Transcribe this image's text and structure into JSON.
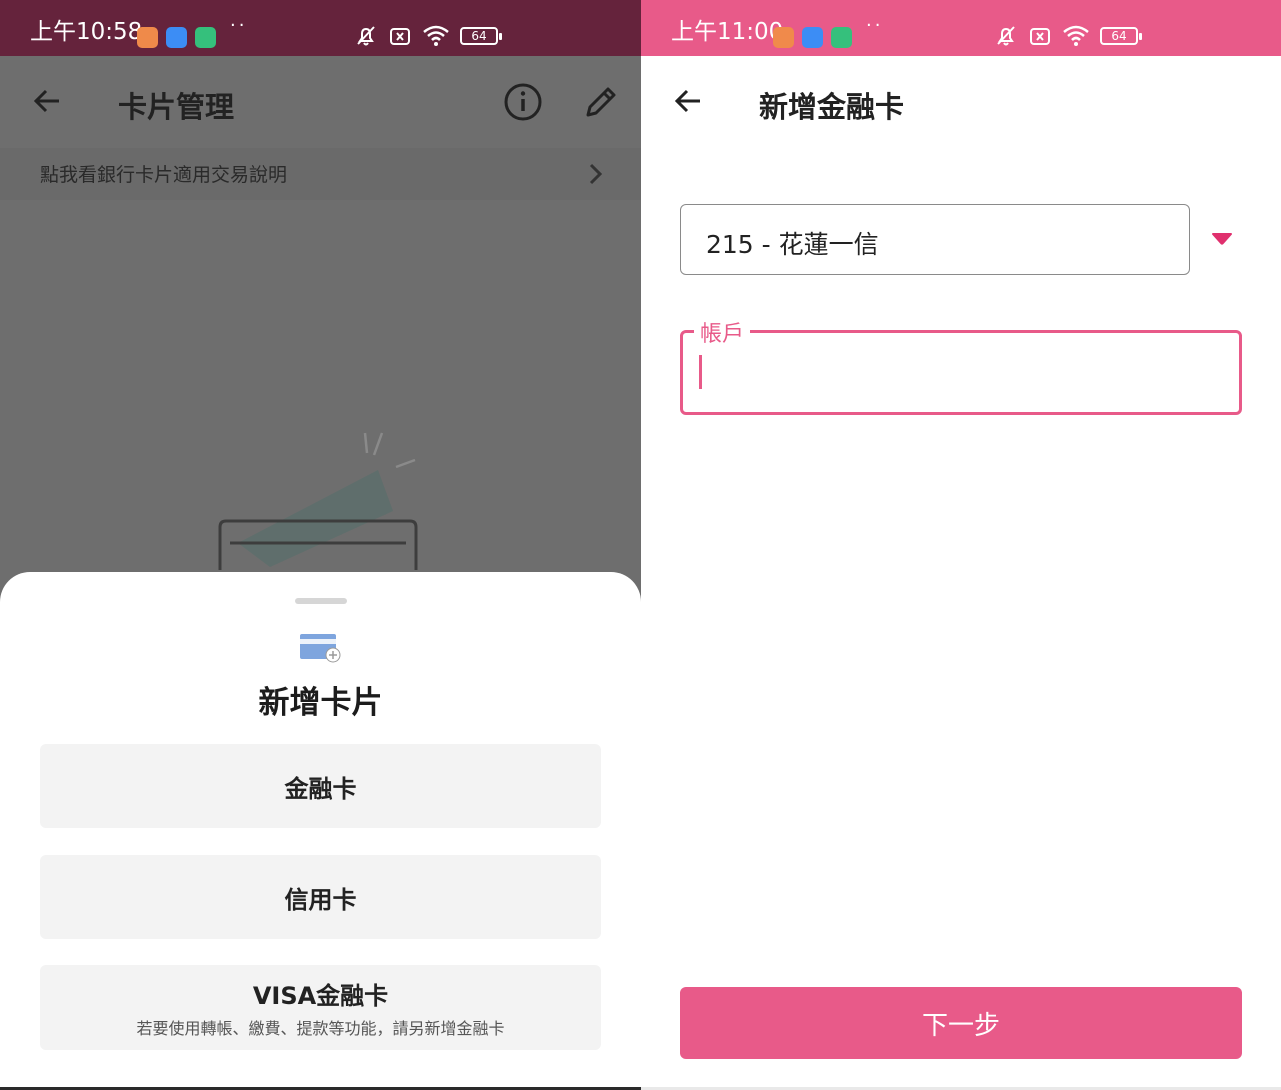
{
  "left": {
    "status": {
      "time": "上午10:58",
      "dots": "··",
      "battery": "64"
    },
    "appbar": {
      "title": "卡片管理",
      "back_icon": "arrow-left-icon",
      "info_icon": "info-circle-icon",
      "edit_icon": "pencil-icon"
    },
    "info_row": {
      "text": "點我看銀行卡片適用交易說明",
      "icon": "chevron-right-icon"
    },
    "sheet": {
      "title": "新增卡片",
      "icon": "add-card-icon",
      "options": [
        {
          "label": "金融卡",
          "note": ""
        },
        {
          "label": "信用卡",
          "note": ""
        },
        {
          "label": "VISA金融卡",
          "note": "若要使用轉帳、繳費、提款等功能，請另新增金融卡"
        }
      ]
    },
    "colors": {
      "statusbar": "#65233c",
      "overlay": "#6e6e6e"
    }
  },
  "right": {
    "status": {
      "time": "上午11:00",
      "dots": "··",
      "battery": "64"
    },
    "appbar": {
      "title": "新增金融卡",
      "back_icon": "arrow-left-icon"
    },
    "form": {
      "bank_value": "215 - 花蓮一信",
      "bank_dropdown_icon": "triangle-down-icon",
      "account_label": "帳戶",
      "account_value": ""
    },
    "next_button": "下一步",
    "colors": {
      "accent": "#e85a89"
    }
  }
}
